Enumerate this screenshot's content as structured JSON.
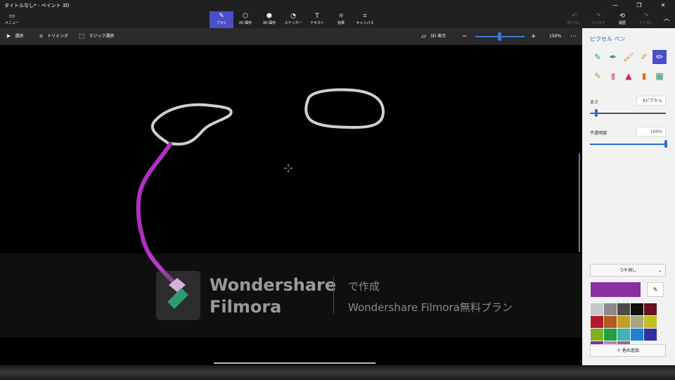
{
  "window": {
    "title": "タイトルなし* - ペイント 3D",
    "minimize": "—",
    "maximize": "❐",
    "close": "✕"
  },
  "ribbon": {
    "menu": "メニュー",
    "tools": [
      {
        "label": "ブラシ",
        "icon": "brush-icon"
      },
      {
        "label": "2D 図形",
        "icon": "shapes-2d-icon"
      },
      {
        "label": "3D 図形",
        "icon": "shapes-3d-icon"
      },
      {
        "label": "ステッカー",
        "icon": "sticker-icon"
      },
      {
        "label": "テキスト",
        "icon": "text-icon"
      },
      {
        "label": "効果",
        "icon": "effects-icon"
      },
      {
        "label": "キャンバス",
        "icon": "canvas-icon"
      }
    ],
    "undo": "取り消し",
    "redo": "元に戻す",
    "history": "履歴",
    "redo2": "やり直し"
  },
  "toolbar": {
    "select": "選択",
    "crop": "トリミング",
    "magic_select": "マジック選択",
    "view3d": "3D 表示",
    "zoom": "150%",
    "zoom_level": 0.48
  },
  "panel": {
    "title": "ピクセル ペン",
    "thickness_label": "太さ",
    "thickness_value": "8ピクセル",
    "thickness_level": 0.08,
    "opacity_label": "不透明度",
    "opacity_value": "100%",
    "opacity_level": 1.0,
    "finish": "つや消し",
    "add_color": "色の追加",
    "current_color": "#8a2fa0",
    "palette": [
      "#c8c8c8",
      "#8a8a8a",
      "#4a4a4a",
      "#101010",
      "#6a1020",
      "#b01a2a",
      "#b05a20",
      "#c0a020",
      "#a8a880",
      "#c0c020",
      "#80b020",
      "#20a040",
      "#40b0b0",
      "#2080d0",
      "#3030a0",
      "#8030a0",
      "#c080c0",
      "#a060a0"
    ]
  },
  "watermark": {
    "brand_line1": "Wondershare",
    "brand_line2": "Filmora",
    "made_with": "で作成",
    "plan": "Wondershare Filmora無料プラン"
  }
}
